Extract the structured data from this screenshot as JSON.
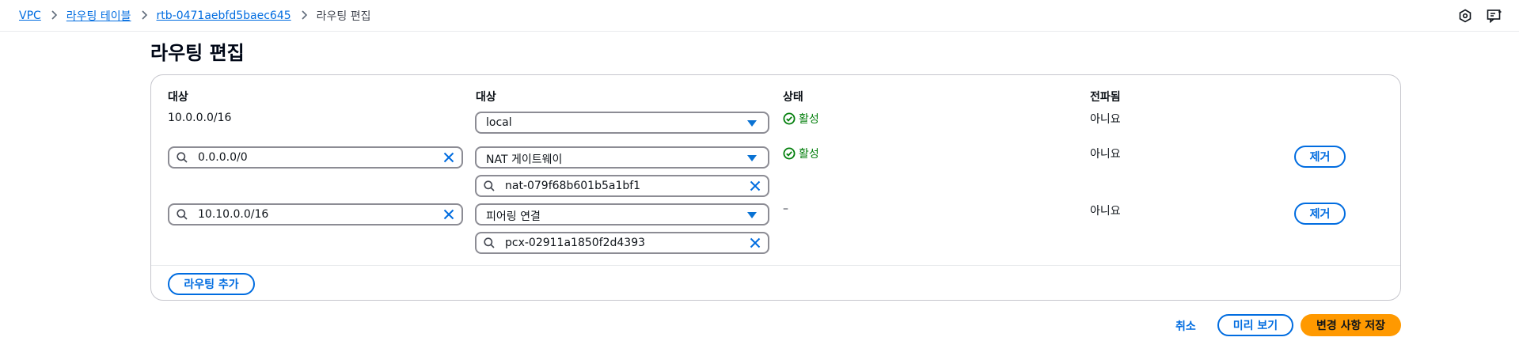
{
  "breadcrumb": {
    "items": [
      "VPC",
      "라우팅 테이블",
      "rtb-0471aebfd5baec645"
    ],
    "current": "라우팅 편집"
  },
  "page": {
    "title": "라우팅 편집"
  },
  "columns": {
    "destination": "대상",
    "target": "대상",
    "status": "상태",
    "propagated": "전파됨"
  },
  "routes": [
    {
      "destination": "10.0.0.0/16",
      "target_type": "local",
      "status": "활성",
      "propagated": "아니요"
    },
    {
      "destination": "0.0.0.0/0",
      "target_type": "NAT 게이트웨이",
      "target_id": "nat-079f68b601b5a1bf1",
      "status": "활성",
      "propagated": "아니요",
      "remove_label": "제거"
    },
    {
      "destination": "10.10.0.0/16",
      "target_type": "피어링 연결",
      "target_id": "pcx-02911a1850f2d4393",
      "status": "–",
      "propagated": "아니요",
      "remove_label": "제거"
    }
  ],
  "add_route_label": "라우팅 추가",
  "footer": {
    "cancel_label": "취소",
    "preview_label": "미리 보기",
    "save_label": "변경 사항 저장"
  },
  "colors": {
    "link": "#006ce0",
    "success": "#037f0c",
    "primary": "#ff9900",
    "border": "#8c8c94"
  },
  "icons": [
    "chevron-right-icon",
    "search-icon",
    "clear-icon",
    "caret-down-icon",
    "status-success-icon",
    "settings-hex-icon",
    "feedback-icon"
  ]
}
